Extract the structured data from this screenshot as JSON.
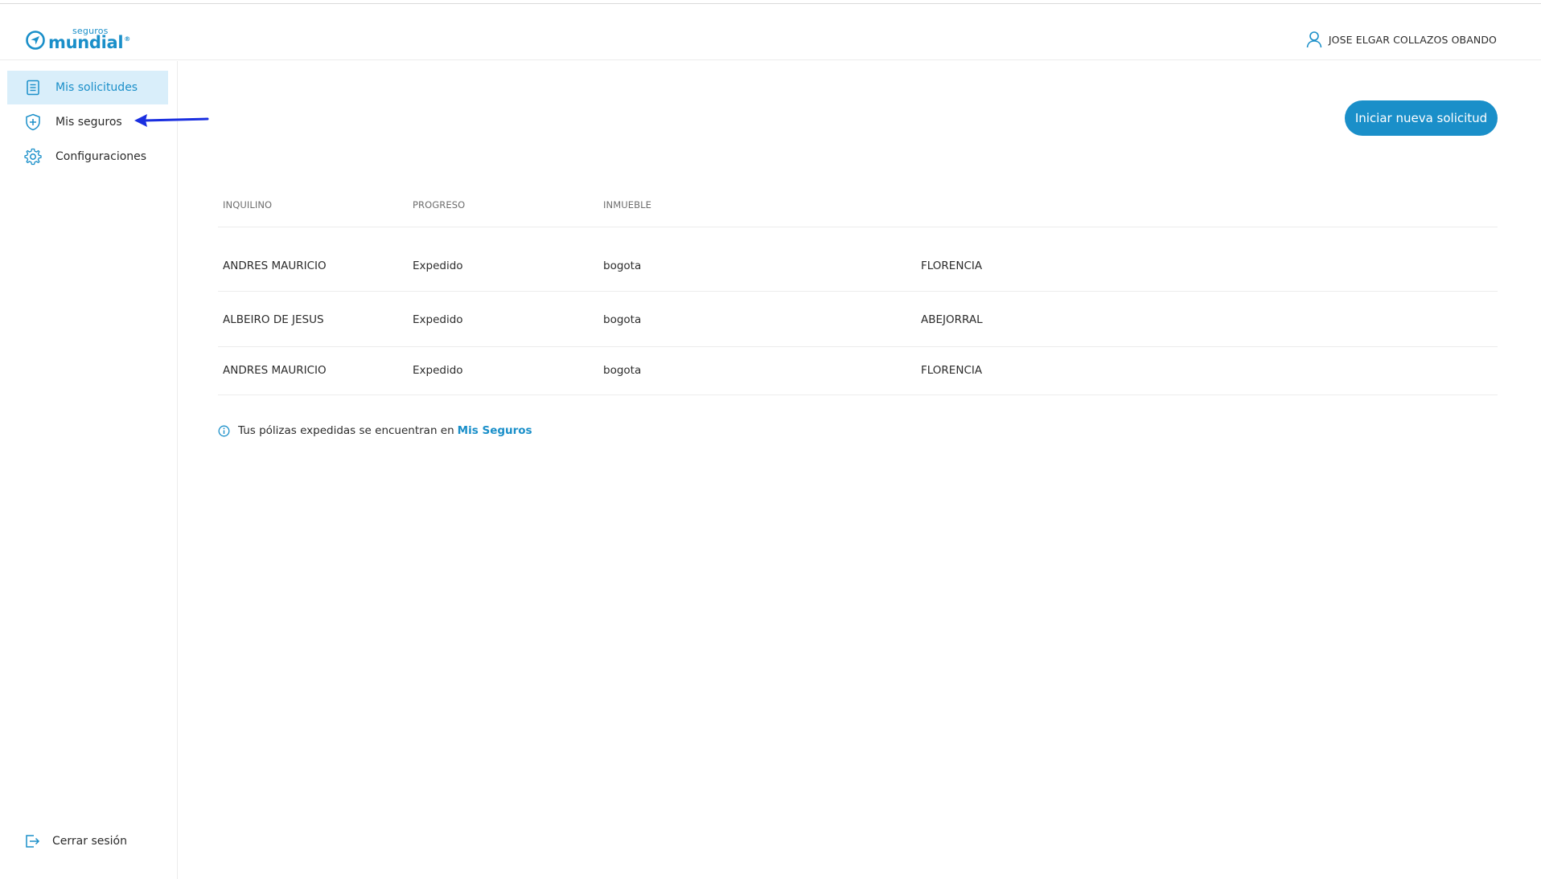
{
  "header": {
    "logo_top": "seguros",
    "logo_main": "mundial",
    "logo_reg": "®",
    "user_name": "JOSE ELGAR COLLAZOS OBANDO"
  },
  "sidebar": {
    "items": [
      {
        "label": "Mis solicitudes",
        "icon": "document-icon",
        "active": true
      },
      {
        "label": "Mis seguros",
        "icon": "shield-plus-icon",
        "active": false
      },
      {
        "label": "Configuraciones",
        "icon": "gear-icon",
        "active": false
      }
    ],
    "logout_label": "Cerrar sesión"
  },
  "main": {
    "new_request_label": "Iniciar nueva solicitud",
    "table": {
      "headers": [
        "INQUILINO",
        "PROGRESO",
        "INMUEBLE",
        ""
      ],
      "rows": [
        [
          "ANDRES MAURICIO",
          "Expedido",
          "bogota",
          "FLORENCIA"
        ],
        [
          "ALBEIRO DE JESUS",
          "Expedido",
          "bogota",
          "ABEJORRAL"
        ],
        [
          "ANDRES MAURICIO",
          "Expedido",
          "bogota",
          "FLORENCIA"
        ]
      ]
    },
    "info_text": "Tus pólizas expedidas se encuentran en",
    "info_link": "Mis Seguros"
  },
  "colors": {
    "accent": "#1a8fc9",
    "active_bg": "#d9eefa",
    "annotation_arrow": "#1a2fe0"
  }
}
